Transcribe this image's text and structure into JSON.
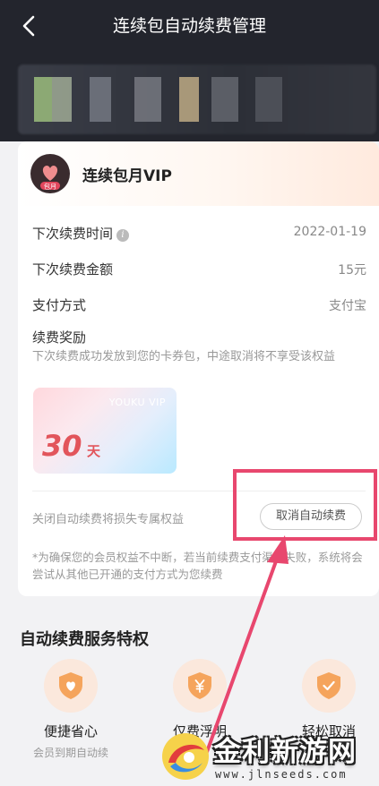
{
  "header": {
    "title": "连续包自动续费管理"
  },
  "colors": {
    "header_bg": "#23252d",
    "accent_red": "#e8476e",
    "coupon_red": "#e2555b",
    "privilege_orange": "#f5a45c"
  },
  "card": {
    "name": "连续包月VIP",
    "badge_text": "包月",
    "rows": [
      {
        "label": "下次续费时间",
        "value": "2022-01-19"
      },
      {
        "label": "下次续费金额",
        "value": "15元"
      },
      {
        "label": "支付方式",
        "value": "支付宝"
      }
    ],
    "reward_title": "续费奖励",
    "reward_desc": "下次续费成功发放到您的卡券包，中途取消将不享受该权益",
    "coupon": {
      "brand": "YOUKU VIP",
      "number": "30",
      "unit": "天"
    },
    "loss_text": "关闭自动续费将损失专属权益",
    "cancel_label": "取消自动续费",
    "note": "*为确保您的会员权益不中断，若当前续费支付渠道失败，系统将会尝试从其他已开通的支付方式为您续费"
  },
  "privileges": {
    "title": "自动续费服务特权",
    "items": [
      {
        "title": "便捷省心",
        "sub": "会员到期自动续",
        "icon": "heart-shield-icon"
      },
      {
        "title": "仅费浮明",
        "sub": "",
        "icon": "yuan-shield-icon"
      },
      {
        "title": "轻松取消",
        "sub": "",
        "icon": "check-shield-icon"
      }
    ]
  },
  "watermark": {
    "text": "金利新游网",
    "url": "www.jlnseeds.com"
  }
}
